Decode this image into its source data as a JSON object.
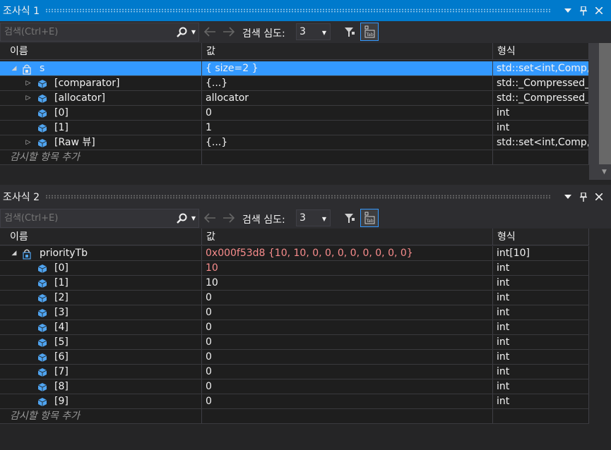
{
  "watch1": {
    "title": "조사식 1",
    "search_placeholder": "검색(Ctrl+E)",
    "depth_label": "검색 심도:",
    "depth_value": "3",
    "headers": {
      "name": "이름",
      "value": "값",
      "type": "형식"
    },
    "rows": [
      {
        "name": "s",
        "value": "{ size=2 }",
        "type": "std::set<int,Comp,..."
      },
      {
        "name": "[comparator]",
        "value": "{...}",
        "type": "std::_Compressed_..."
      },
      {
        "name": "[allocator]",
        "value": "allocator",
        "type": "std::_Compressed_..."
      },
      {
        "name": "[0]",
        "value": "0",
        "type": "int"
      },
      {
        "name": "[1]",
        "value": "1",
        "type": "int"
      },
      {
        "name": "[Raw 뷰]",
        "value": "{...}",
        "type": "std::set<int,Comp,..."
      }
    ],
    "add_watch": "감시할 항목 추가"
  },
  "watch2": {
    "title": "조사식 2",
    "search_placeholder": "검색(Ctrl+E)",
    "depth_label": "검색 심도:",
    "depth_value": "3",
    "headers": {
      "name": "이름",
      "value": "값",
      "type": "형식"
    },
    "rows": [
      {
        "name": "priorityTb",
        "value": "0x000f53d8 {10, 10, 0, 0, 0, 0, 0, 0, 0, 0}",
        "type": "int[10]"
      },
      {
        "name": "[0]",
        "value": "10",
        "type": "int"
      },
      {
        "name": "[1]",
        "value": "10",
        "type": "int"
      },
      {
        "name": "[2]",
        "value": "0",
        "type": "int"
      },
      {
        "name": "[3]",
        "value": "0",
        "type": "int"
      },
      {
        "name": "[4]",
        "value": "0",
        "type": "int"
      },
      {
        "name": "[5]",
        "value": "0",
        "type": "int"
      },
      {
        "name": "[6]",
        "value": "0",
        "type": "int"
      },
      {
        "name": "[7]",
        "value": "0",
        "type": "int"
      },
      {
        "name": "[8]",
        "value": "0",
        "type": "int"
      },
      {
        "name": "[9]",
        "value": "0",
        "type": "int"
      }
    ],
    "add_watch": "감시할 항목 추가"
  },
  "icons": {
    "dropdown": "chevron-down-icon",
    "pin": "pin-icon",
    "close": "close-icon",
    "search": "search-icon",
    "back": "arrow-left-icon",
    "forward": "arrow-right-icon",
    "filter": "filter-icon",
    "tab": "tab-icon",
    "variable": "variable-cube-icon",
    "object": "object-lock-icon"
  },
  "colors": {
    "accent": "#007acc",
    "selection": "#3399ff",
    "changed_value": "#f88c8c",
    "variable_icon": "#4fa4f0"
  }
}
